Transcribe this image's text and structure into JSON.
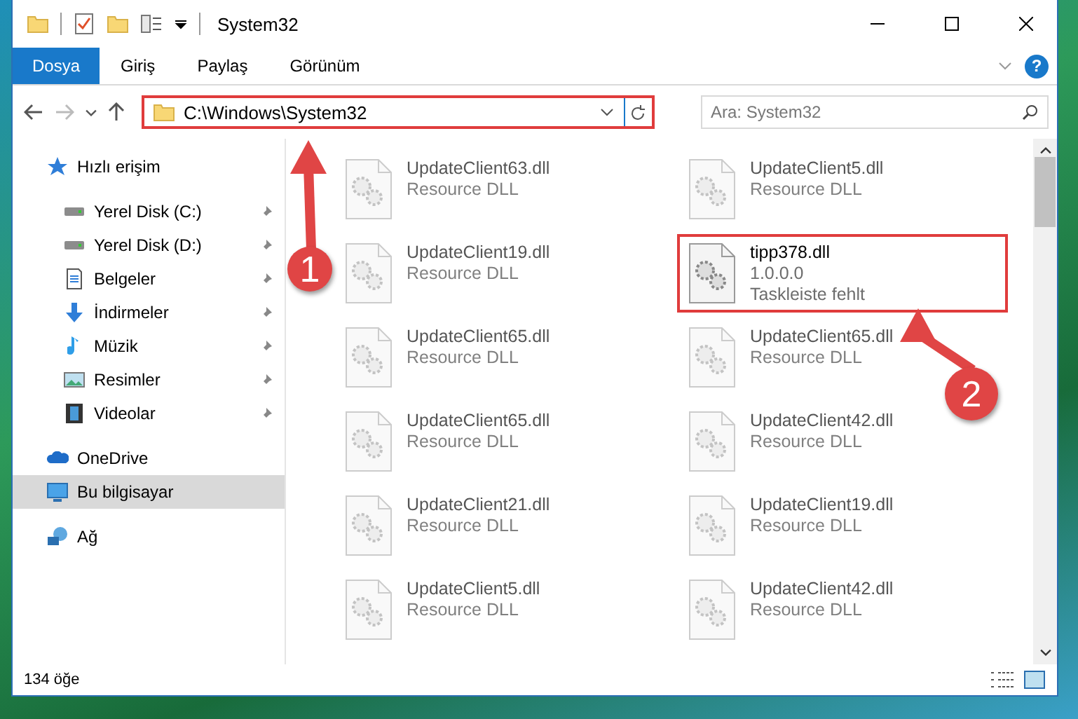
{
  "window": {
    "title": "System32"
  },
  "ribbon": {
    "tabs": [
      {
        "label": "Dosya",
        "kind": "file"
      },
      {
        "label": "Giriş",
        "kind": "tab"
      },
      {
        "label": "Paylaş",
        "kind": "tab"
      },
      {
        "label": "Görünüm",
        "kind": "tab"
      }
    ],
    "help": "?"
  },
  "address": {
    "path": "C:\\Windows\\System32",
    "highlighted": true
  },
  "search": {
    "placeholder": "Ara: System32"
  },
  "sidebar": {
    "items": [
      {
        "label": "Hızlı erişim",
        "selected": false,
        "children": [
          {
            "label": "Yerel Disk (C:)",
            "pinned": true,
            "selected": false
          },
          {
            "label": "Yerel Disk (D:)",
            "pinned": true,
            "selected": false
          },
          {
            "label": "Belgeler",
            "pinned": true,
            "selected": false
          },
          {
            "label": "İndirmeler",
            "pinned": true,
            "selected": false
          },
          {
            "label": "Müzik",
            "pinned": true,
            "selected": false
          },
          {
            "label": "Resimler",
            "pinned": true,
            "selected": false
          },
          {
            "label": "Videolar",
            "pinned": true,
            "selected": false
          }
        ]
      },
      {
        "label": "OneDrive",
        "selected": false
      },
      {
        "label": "Bu bilgisayar",
        "selected": true
      },
      {
        "label": "Ağ",
        "selected": false
      }
    ]
  },
  "files": [
    {
      "name": "UpdateClient63.dll",
      "details": [
        "Resource DLL"
      ],
      "highlighted": false
    },
    {
      "name": "UpdateClient5.dll",
      "details": [
        "Resource DLL"
      ],
      "highlighted": false
    },
    {
      "name": "UpdateClient19.dll",
      "details": [
        "Resource DLL"
      ],
      "highlighted": false
    },
    {
      "name": "tipp378.dll",
      "details": [
        "1.0.0.0",
        "Taskleiste fehlt"
      ],
      "highlighted": true
    },
    {
      "name": "UpdateClient65.dll",
      "details": [
        "Resource DLL"
      ],
      "highlighted": false
    },
    {
      "name": "UpdateClient65.dll",
      "details": [
        "Resource DLL"
      ],
      "highlighted": false
    },
    {
      "name": "UpdateClient65.dll",
      "details": [
        "Resource DLL"
      ],
      "highlighted": false
    },
    {
      "name": "UpdateClient42.dll",
      "details": [
        "Resource DLL"
      ],
      "highlighted": false
    },
    {
      "name": "UpdateClient21.dll",
      "details": [
        "Resource DLL"
      ],
      "highlighted": false
    },
    {
      "name": "UpdateClient19.dll",
      "details": [
        "Resource DLL"
      ],
      "highlighted": false
    },
    {
      "name": "UpdateClient5.dll",
      "details": [
        "Resource DLL"
      ],
      "highlighted": false
    },
    {
      "name": "UpdateClient42.dll",
      "details": [
        "Resource DLL"
      ],
      "highlighted": false
    }
  ],
  "status_bar": {
    "count": "134 öğe"
  },
  "annotations": [
    {
      "label": "1"
    },
    {
      "label": "2"
    }
  ]
}
